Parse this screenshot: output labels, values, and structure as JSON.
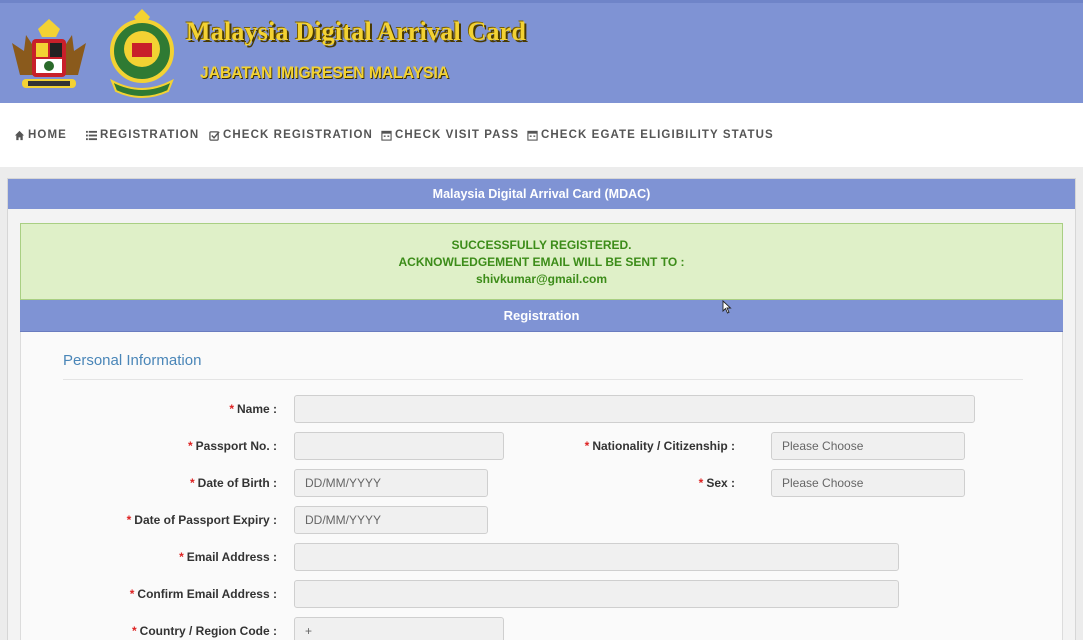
{
  "header": {
    "title": "Malaysia Digital Arrival Card",
    "subtitle": "JABATAN IMIGRESEN MALAYSIA",
    "crest_icons": [
      "malaysia-coat-of-arms-icon",
      "immigration-department-crest-icon"
    ]
  },
  "nav": {
    "items": [
      {
        "label": "HOME",
        "icon": "home-icon"
      },
      {
        "label": "REGISTRATION",
        "icon": "list-icon"
      },
      {
        "label": "CHECK REGISTRATION",
        "icon": "check-icon"
      },
      {
        "label": "CHECK VISIT PASS",
        "icon": "calendar-icon"
      },
      {
        "label": "CHECK EGATE ELIGIBILITY STATUS",
        "icon": "calendar-icon"
      }
    ]
  },
  "panel": {
    "title": "Malaysia Digital Arrival Card (MDAC)",
    "success": {
      "line1": "SUCCESSFULLY REGISTERED.",
      "line2": "ACKNOWLEDGEMENT EMAIL WILL BE SENT TO :",
      "email": "shivkumar@gmail.com"
    },
    "registration_title": "Registration",
    "section_title": "Personal Information"
  },
  "form": {
    "required_mark": "*",
    "name": {
      "label": "Name :",
      "value": ""
    },
    "passport": {
      "label": "Passport No. :",
      "value": ""
    },
    "nationality": {
      "label": "Nationality / Citizenship :",
      "value": "Please Choose"
    },
    "dob": {
      "label": "Date of Birth :",
      "placeholder": "DD/MM/YYYY"
    },
    "sex": {
      "label": "Sex :",
      "value": "Please Choose"
    },
    "passport_expiry": {
      "label": "Date of Passport Expiry :",
      "placeholder": "DD/MM/YYYY"
    },
    "email": {
      "label": "Email Address :",
      "value": ""
    },
    "confirm_email": {
      "label": "Confirm Email Address :",
      "value": ""
    },
    "country_code": {
      "label": "Country / Region Code :",
      "value": "+"
    }
  },
  "colors": {
    "brand_blue": "#7f93d4",
    "title_gold": "#f3d233",
    "success_bg": "#dff0c8",
    "success_text": "#3c8c19",
    "required_red": "#dd2222"
  }
}
